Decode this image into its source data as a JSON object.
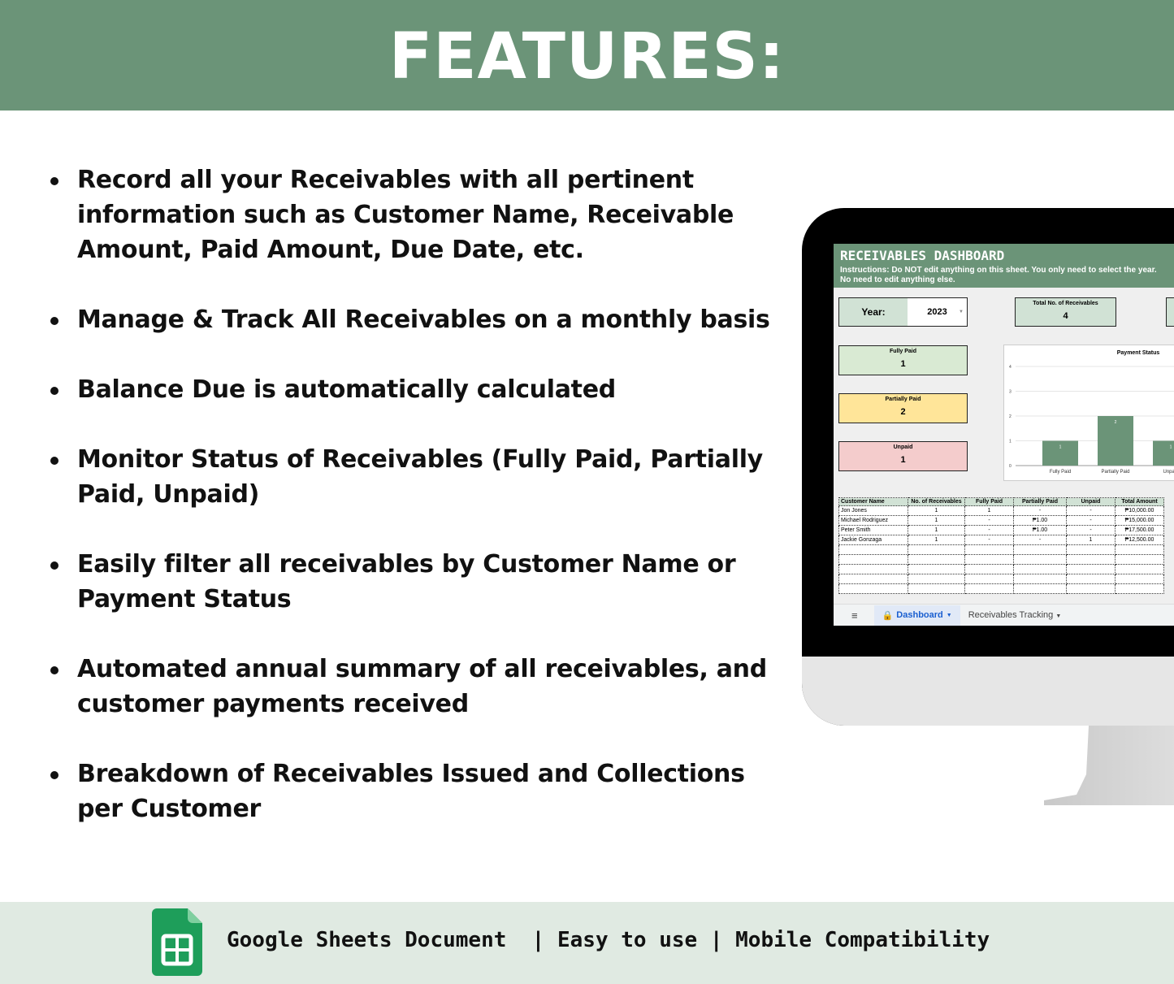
{
  "header": {
    "title": "FEATURES:"
  },
  "features": [
    "Record all your Receivables with all pertinent information such as Customer Name, Receivable Amount, Paid Amount, Due Date, etc.",
    "Manage & Track All Receivables on a monthly basis",
    "Balance Due is automatically calculated",
    "Monitor Status of Receivables (Fully Paid, Partially Paid, Unpaid)",
    "Easily filter all receivables by Customer Name or Payment Status",
    "Automated annual summary of all receivables, and customer payments received",
    "Breakdown of Receivables Issued and Collections per Customer"
  ],
  "dashboard": {
    "title": "RECEIVABLES DASHBOARD",
    "instructions": "Instructions: Do NOT edit anything on this sheet. You only need to select the year. No need to edit anything else.",
    "year_label": "Year:",
    "year_value": "2023",
    "total_label": "Total No. of Receivables",
    "total_value": "4",
    "fully_label": "Fully Paid",
    "fully_value": "1",
    "partial_label": "Partially Paid",
    "partial_value": "2",
    "unpaid_label": "Unpaid",
    "unpaid_value": "1",
    "colors": {
      "green": "#6b9478",
      "fully": "#d9ead3",
      "partial": "#ffe599",
      "unpaid": "#f4cccc"
    },
    "table": {
      "headers": [
        "Customer Name",
        "No. of Receivables",
        "Fully Paid",
        "Partially Paid",
        "Unpaid",
        "Total Amount"
      ],
      "rows": [
        [
          "Jon Jones",
          "1",
          "1",
          "-",
          "-",
          "₱10,000.00"
        ],
        [
          "Michael Rodriguez",
          "1",
          "-",
          "₱1.00",
          "-",
          "₱15,000.00"
        ],
        [
          "Peter Smith",
          "1",
          "-",
          "₱1.00",
          "-",
          "₱17,500.00"
        ],
        [
          "Jackie Gonzaga",
          "1",
          "-",
          "-",
          "1",
          "₱12,500.00"
        ]
      ]
    },
    "tabs": {
      "active": "Dashboard",
      "other": "Receivables Tracking"
    }
  },
  "chart_data": {
    "type": "bar",
    "title": "Payment Status",
    "categories": [
      "Fully Paid",
      "Partially Paid",
      "Unpaid"
    ],
    "values": [
      1,
      2,
      1
    ],
    "ylim": [
      0,
      4
    ],
    "yticks": [
      0,
      1,
      2,
      3,
      4
    ],
    "grid": true,
    "color": "#6b9478"
  },
  "footer": {
    "text": "Google Sheets Document  | Easy to use | Mobile Compatibility",
    "icon": "google-sheets-icon"
  }
}
